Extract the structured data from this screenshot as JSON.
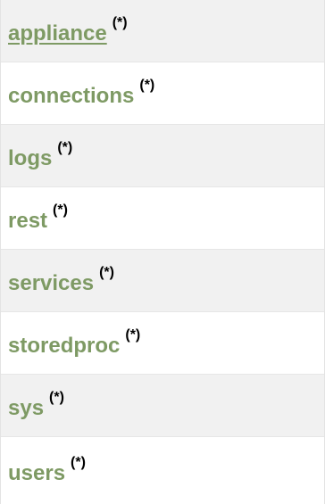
{
  "items": [
    {
      "label": "appliance",
      "marker": "(*)"
    },
    {
      "label": "connections",
      "marker": "(*)"
    },
    {
      "label": "logs",
      "marker": "(*)"
    },
    {
      "label": "rest",
      "marker": "(*)"
    },
    {
      "label": "services",
      "marker": "(*)"
    },
    {
      "label": "storedproc",
      "marker": "(*)"
    },
    {
      "label": "sys",
      "marker": "(*)"
    },
    {
      "label": "users",
      "marker": "(*)"
    }
  ],
  "colors": {
    "link": "#7e9a64",
    "marker": "#000000",
    "row_alt": "#f1f1f1"
  }
}
